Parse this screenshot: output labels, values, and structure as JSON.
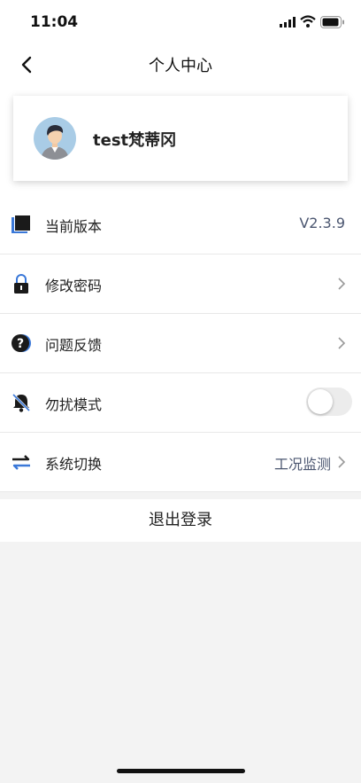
{
  "status_bar": {
    "time": "11:04"
  },
  "header": {
    "title": "个人中心"
  },
  "profile": {
    "username": "test梵蒂冈"
  },
  "menu": [
    {
      "label": "当前版本",
      "value": "V2.3.9",
      "icon": "version-icon"
    },
    {
      "label": "修改密码",
      "icon": "lock-icon"
    },
    {
      "label": "问题反馈",
      "icon": "question-icon"
    },
    {
      "label": "勿扰模式",
      "icon": "bell-off-icon",
      "toggle_on": false
    },
    {
      "label": "系统切换",
      "value": "工况监测",
      "icon": "switch-icon"
    }
  ],
  "logout": {
    "label": "退出登录"
  },
  "colors": {
    "accent": "#3a78d8",
    "value_text": "#4b5670",
    "background": "#f3f3f3"
  }
}
